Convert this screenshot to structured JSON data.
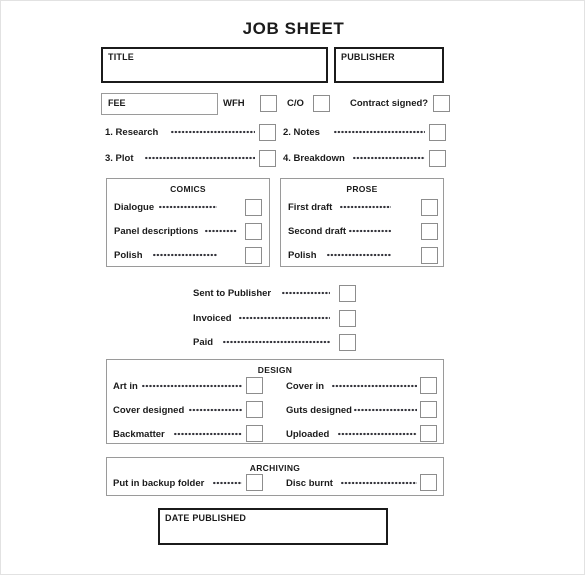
{
  "document": {
    "title": "JOB SHEET"
  },
  "header_fields": {
    "title_label": "TITLE",
    "title_value": "",
    "publisher_label": "PUBLISHER",
    "publisher_value": ""
  },
  "fee_row": {
    "fee_label": "FEE",
    "fee_value": "",
    "wfh_label": "WFH",
    "co_label": "C/O",
    "contract_label": "Contract signed?"
  },
  "numbered_tasks": [
    {
      "label": "1.  Research"
    },
    {
      "label": "2.  Notes"
    },
    {
      "label": "3.  Plot"
    },
    {
      "label": "4.  Breakdown"
    }
  ],
  "comics_group": {
    "caption": "COMICS",
    "items": [
      {
        "label": "Dialogue"
      },
      {
        "label": "Panel descriptions"
      },
      {
        "label": "Polish"
      }
    ]
  },
  "prose_group": {
    "caption": "PROSE",
    "items": [
      {
        "label": "First draft"
      },
      {
        "label": "Second draft"
      },
      {
        "label": "Polish"
      }
    ]
  },
  "delivery_items": [
    {
      "label": "Sent to Publisher"
    },
    {
      "label": "Invoiced"
    },
    {
      "label": "Paid"
    }
  ],
  "design_group": {
    "caption": "DESIGN",
    "left_items": [
      {
        "label": "Art in"
      },
      {
        "label": "Cover designed"
      },
      {
        "label": "Backmatter"
      }
    ],
    "right_items": [
      {
        "label": "Cover in"
      },
      {
        "label": "Guts designed"
      },
      {
        "label": "Uploaded"
      }
    ]
  },
  "archiving_group": {
    "caption": "ARCHIVING",
    "left_items": [
      {
        "label": "Put in backup folder"
      }
    ],
    "right_items": [
      {
        "label": "Disc burnt"
      }
    ]
  },
  "date_published": {
    "label": "DATE PUBLISHED",
    "value": ""
  },
  "colors": {
    "text": "#1b1b1b",
    "heavy_border": "#1b1b1b",
    "light_border": "#9a9a9a",
    "checkbox_border": "#8d8d8d",
    "page_background": "#ffffff",
    "page_border": "#e2e2e2"
  }
}
